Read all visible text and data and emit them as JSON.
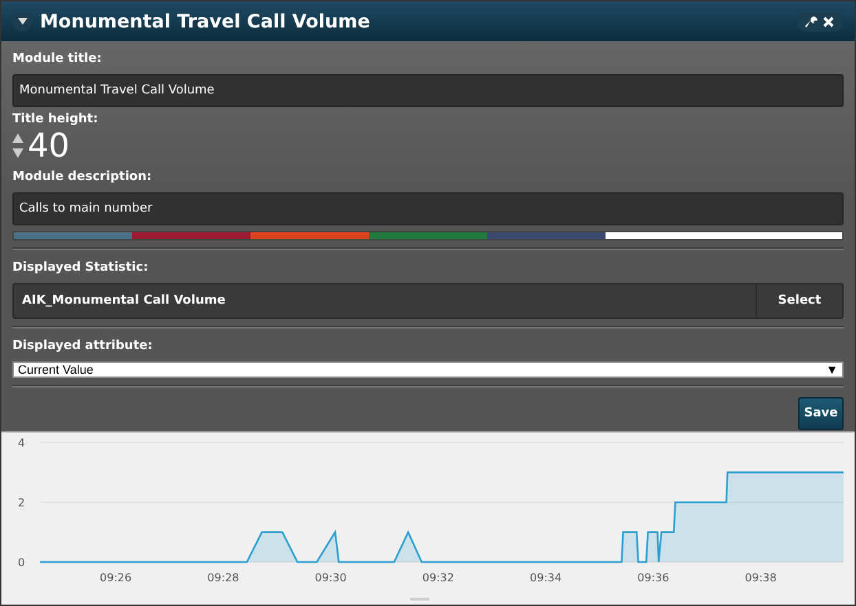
{
  "window": {
    "title": "Monumental Travel Call Volume"
  },
  "form": {
    "module_title": {
      "label": "Module title:",
      "value": "Monumental Travel Call Volume"
    },
    "title_height": {
      "label": "Title height:",
      "value": "40"
    },
    "module_description": {
      "label": "Module description:",
      "value": "Calls to main number"
    },
    "color_swatches": [
      {
        "color": "#4a7185"
      },
      {
        "color": "#9b1b30"
      },
      {
        "color": "#d9441f"
      },
      {
        "color": "#217a3d"
      },
      {
        "color": "#3a4a6e"
      },
      {
        "color": "#ffffff"
      }
    ],
    "displayed_statistic": {
      "label": "Displayed Statistic:",
      "value": "AIK_Monumental Call Volume",
      "button": "Select"
    },
    "displayed_attribute": {
      "label": "Displayed attribute:",
      "value": "Current Value",
      "arrow": "▼"
    },
    "save_button": "Save"
  },
  "chart": {
    "chart_data": {
      "type": "area",
      "x": [
        564.59,
        568.44,
        568.72,
        569.1,
        569.38,
        569.74,
        570.08,
        570.15,
        571.18,
        571.44,
        571.69,
        575.41,
        575.44,
        575.69,
        575.72,
        575.87,
        575.9,
        576.08,
        576.1,
        576.15,
        576.38,
        576.41,
        577.36,
        577.38,
        579.54
      ],
      "series": [
        {
          "color": "#2b9fd0",
          "values": [
            0,
            0,
            1,
            1,
            0,
            0,
            1,
            0,
            0,
            1,
            0,
            0,
            1,
            1,
            0,
            0,
            1,
            1,
            0,
            1,
            1,
            2,
            2,
            3,
            3
          ]
        }
      ],
      "xlim": [
        564.59,
        579.54
      ],
      "ylim": [
        0,
        4
      ],
      "yticks": [
        0,
        2,
        4
      ],
      "xticks": [
        {
          "value": 566,
          "label": "09:26"
        },
        {
          "value": 568,
          "label": "09:28"
        },
        {
          "value": 570,
          "label": "09:30"
        },
        {
          "value": 572,
          "label": "09:32"
        },
        {
          "value": 574,
          "label": "09:34"
        },
        {
          "value": 576,
          "label": "09:36"
        },
        {
          "value": 578,
          "label": "09:38"
        }
      ]
    }
  }
}
